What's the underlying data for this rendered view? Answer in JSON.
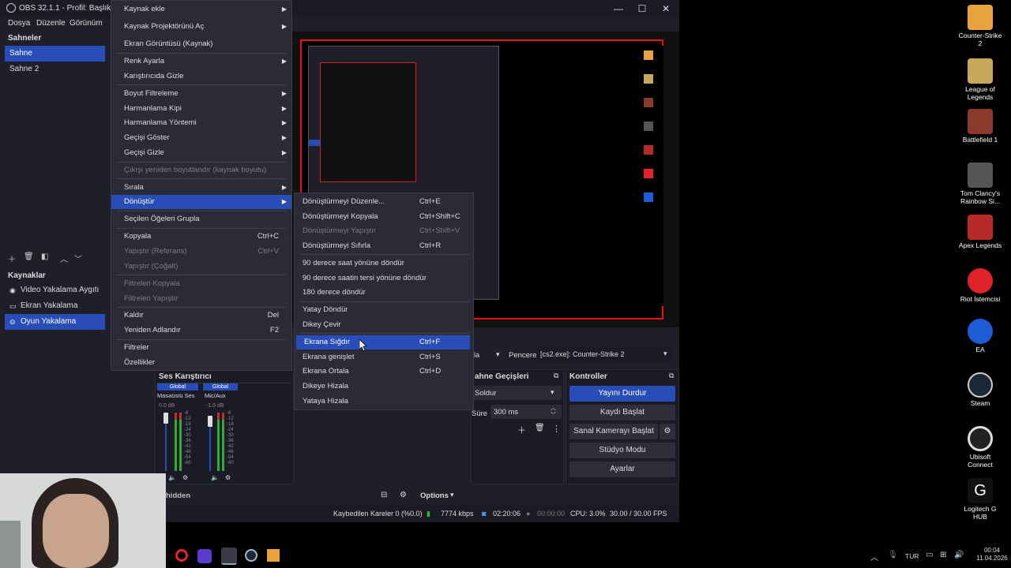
{
  "window": {
    "title": "OBS 32.1.1 - Profil: Başlıksız - S",
    "minimize": "—",
    "maximize": "☐",
    "close": "✕"
  },
  "menubar": [
    "Dosya",
    "Düzenle",
    "Görünüm"
  ],
  "scenes": {
    "header": "Sahneler",
    "items": [
      "Sahne",
      "Sahne 2"
    ],
    "selected": "Sahne"
  },
  "sources": {
    "header": "Kaynaklar",
    "items": [
      "Video Yakalama Aygıtı",
      "Ekran Yakalama",
      "Oyun Yakalama"
    ],
    "selected": "Oyun Yakalama"
  },
  "context_menu": {
    "items": [
      {
        "label": "Kaynak ekle",
        "submenu": true
      },
      {
        "label": "Kaynak Projektörünü Aç",
        "submenu": true
      },
      {
        "label": "Ekran Görüntüsü (Kaynak)"
      },
      {
        "label": "Renk Ayarla",
        "submenu": true
      },
      {
        "label": "Karıştırıcıda Gizle"
      },
      {
        "label": "Boyut Filtreleme",
        "submenu": true
      },
      {
        "label": "Harmanlama Kipi",
        "submenu": true
      },
      {
        "label": "Harmanlama Yöntemi",
        "submenu": true
      },
      {
        "label": "Geçişi Göster",
        "submenu": true
      },
      {
        "label": "Geçişi Gizle",
        "submenu": true
      },
      {
        "label": "Çıkışı yeniden boyutlandır (kaynak boyutu)",
        "disabled": true
      },
      {
        "label": "Sırala",
        "submenu": true
      },
      {
        "label": "Dönüştür",
        "submenu": true,
        "highlighted": true
      },
      {
        "label": "Seçilen Öğeleri Grupla"
      },
      {
        "label": "Kopyala",
        "shortcut": "Ctrl+C"
      },
      {
        "label": "Yapıştır (Referans)",
        "shortcut": "Ctrl+V",
        "disabled": true
      },
      {
        "label": "Yapıştır (Çoğalt)",
        "disabled": true
      },
      {
        "label": "Filtreleri Kopyala",
        "disabled": true
      },
      {
        "label": "Filtreleri Yapıştır",
        "disabled": true
      },
      {
        "label": "Kaldır",
        "shortcut": "Del"
      },
      {
        "label": "Yeniden Adlandır",
        "shortcut": "F2"
      },
      {
        "label": "Filtreler"
      },
      {
        "label": "Özellikler"
      }
    ]
  },
  "transform_menu": {
    "items": [
      {
        "label": "Dönüştürmeyi Düzenle...",
        "shortcut": "Ctrl+E"
      },
      {
        "label": "Dönüştürmeyi Kopyala",
        "shortcut": "Ctrl+Shift+C"
      },
      {
        "label": "Dönüştürmeyi Yapıştır",
        "shortcut": "Ctrl+Shift+V",
        "disabled": true
      },
      {
        "label": "Dönüştürmeyi Sıfırla",
        "shortcut": "Ctrl+R"
      },
      {
        "label": "90 derece saat yönüne döndür"
      },
      {
        "label": "90 derece saatin tersi yönüne döndür"
      },
      {
        "label": "180 derece döndür"
      },
      {
        "label": "Yatay Döndür"
      },
      {
        "label": "Dikey Çevir"
      },
      {
        "label": "Ekrana Sığdır",
        "shortcut": "Ctrl+F",
        "highlighted": true
      },
      {
        "label": "Ekrana genişlet",
        "shortcut": "Ctrl+S"
      },
      {
        "label": "Ekrana Ortala",
        "shortcut": "Ctrl+D"
      },
      {
        "label": "Dikeye Hizala"
      },
      {
        "label": "Yataya Hizala"
      }
    ]
  },
  "source_bar": {
    "window_label": "Pencere",
    "window_value": "[cs2.exe]: Counter-Strike 2",
    "left_fragment": "la"
  },
  "mixer": {
    "header": "Ses Karıştırıcı",
    "channels": [
      {
        "badge": "Global",
        "name": "Masaüstü Ses",
        "db": "0.0 dB"
      },
      {
        "badge": "Global",
        "name": "Mic/Aux",
        "db": "-1.5 dB"
      }
    ],
    "scale": [
      "-6",
      "-12",
      "-18",
      "-24",
      "-30",
      "-36",
      "-42",
      "-48",
      "-54",
      "-60"
    ]
  },
  "transitions": {
    "header": "ahne Geçişleri",
    "type": "Soldur",
    "duration_label": "Süre",
    "duration_value": "300 ms"
  },
  "controls": {
    "header": "Kontroller",
    "buttons": [
      "Yayını Durdur",
      "Kaydı Başlat",
      "Sanal Kamerayı Başlat",
      "Stüdyo Modu",
      "Ayarlar"
    ]
  },
  "bottom": {
    "hidden": "hidden",
    "options": "Options"
  },
  "statusbar": {
    "dropped": "Kaybedilen Kareler 0 (%0.0)",
    "bitrate": "7774 kbps",
    "stream_time": "02:20:06",
    "rec_time": "00:00:00",
    "cpu": "CPU: 3.0%",
    "fps": "30.00 / 30.00 FPS"
  },
  "desktop_icons": [
    {
      "label": "Counter-Strike 2",
      "color": "#e8a33d"
    },
    {
      "label": "League of Legends",
      "color": "#c8a85a"
    },
    {
      "label": "Battlefield 1",
      "color": "#8a3a2a"
    },
    {
      "label": "Tom Clancy's Rainbow Si...",
      "color": "#555555"
    },
    {
      "label": "Apex Legends",
      "color": "#b62a2a"
    },
    {
      "label": "Riot İstemcisi",
      "color": "#e0232a"
    },
    {
      "label": "EA",
      "color": "#1e5bd6"
    },
    {
      "label": "Steam",
      "color": "#1b2838"
    },
    {
      "label": "Ubisoft Connect",
      "color": "#222222"
    },
    {
      "label": "Logitech G HUB",
      "color": "#111111"
    }
  ],
  "tray": {
    "lang": "TUR",
    "time": "00:04",
    "date": "11.04.2026"
  }
}
